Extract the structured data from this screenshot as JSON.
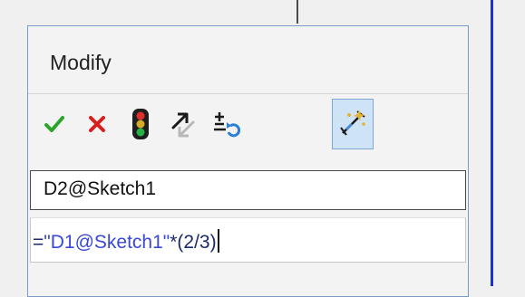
{
  "dialog": {
    "title": "Modify",
    "toolbar": {
      "buttons": [
        {
          "name": "ok",
          "icon": "checkmark-icon",
          "color": "#2aa52a"
        },
        {
          "name": "cancel",
          "icon": "close-icon",
          "color": "#d61f1f"
        },
        {
          "name": "rebuild",
          "icon": "traffic-light-icon"
        },
        {
          "name": "reverse-dimension",
          "icon": "reverse-arrow-icon"
        },
        {
          "name": "spin-increment",
          "icon": "plus-minus-undo-icon"
        },
        {
          "name": "mark-dimension",
          "icon": "dimension-wand-icon",
          "active": true
        }
      ]
    },
    "dimension_name": "D2@Sketch1",
    "equation": {
      "prefix": "=",
      "reference": "\"D1@Sketch1\"",
      "suffix": "*(2/3)"
    }
  },
  "colors": {
    "border_accent": "#1f2fd1",
    "equation_text": "#3848d8"
  }
}
